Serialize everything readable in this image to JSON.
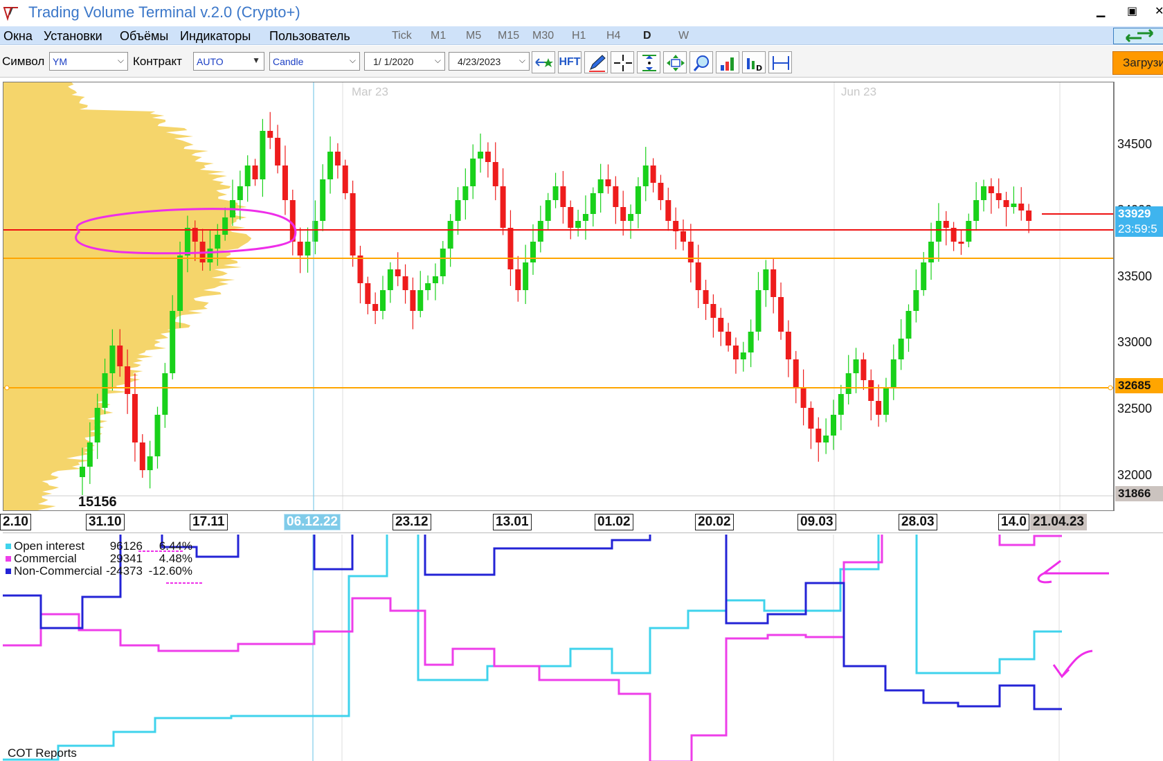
{
  "window": {
    "title": "Trading Volume Terminal v.2.0 (Crypto+)"
  },
  "menu": {
    "items": [
      "Окна",
      "Установки",
      "Объёмы",
      "Индикаторы",
      "Пользователь"
    ],
    "timeframes": [
      "Tick",
      "M1",
      "M5",
      "M15",
      "M30",
      "H1",
      "H4",
      "D",
      "W"
    ],
    "active_timeframe": "D"
  },
  "toolbar": {
    "symbol_label": "Символ",
    "symbol_value": "YM",
    "contract_label": "Контракт",
    "contract_value": "AUTO",
    "chart_type": "Candle",
    "date_from": "1/  1/2020",
    "date_to": "4/23/2023",
    "hft_label": "HFT",
    "load_label": "Загрузить",
    "tool_icons": [
      "arrows-star-icon",
      "hft-icon",
      "pencil-icon",
      "crosshair-icon",
      "vertical-fit-icon",
      "center-icon",
      "zoom-icon",
      "histogram-icon",
      "volume-delta-icon",
      "range-icon"
    ]
  },
  "main_chart": {
    "month_labels": [
      "Mar 23",
      "Jun 23"
    ],
    "price_ticks": [
      "34500",
      "34000",
      "33500",
      "33000",
      "32500",
      "32000"
    ],
    "price_tags": {
      "current": "33929",
      "countdown": "23:59:5",
      "level": "32685",
      "low": "31866"
    },
    "profile_label": "15156",
    "colors": {
      "bull": "#19d11a",
      "bear": "#ee1c1c",
      "profile": "#f5d56b",
      "level_orange": "#ffa500",
      "level_red": "#e11",
      "annotation": "#ee2ee9",
      "cursor": "#7fcbe9"
    }
  },
  "date_axis": {
    "labels": [
      "2.10",
      "31.10",
      "17.11",
      "06.12.22",
      "23.12",
      "13.01",
      "01.02",
      "20.02",
      "09.03",
      "28.03",
      "14.0",
      "21.04.23"
    ],
    "highlight": "06.12.22",
    "current": "21.04.23"
  },
  "cot": {
    "title": "COT Reports",
    "legend": [
      {
        "name": "Open interest",
        "value": "96126",
        "pct": "6.44%",
        "color": "#3fd3ec"
      },
      {
        "name": "Commercial",
        "value": "29341",
        "pct": "4.48%",
        "color": "#ee3ee9"
      },
      {
        "name": "Non-Commercial",
        "value": "-24373",
        "pct": "-12.60%",
        "color": "#2323d6"
      }
    ]
  }
}
